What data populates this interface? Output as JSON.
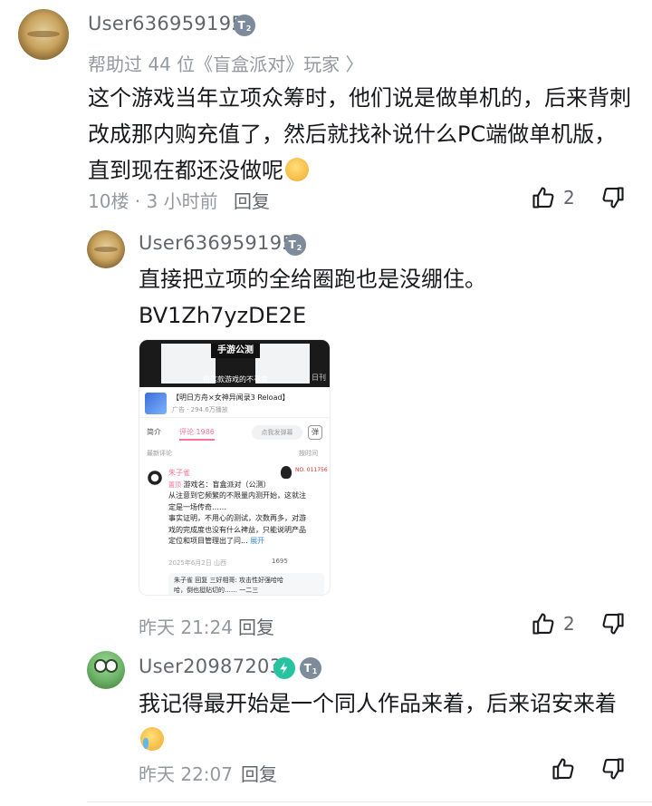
{
  "comment1": {
    "username": "User636959195",
    "badge": "T2",
    "helped": "帮助过 44 位《盲盒派对》玩家 〉",
    "text": "这个游戏当年立项众筹时，他们说是做单机的，后来背刺改成那内购充值了，然后就找补说什么PC端做单机版，直到现在都还没做呢",
    "meta": "10楼 · 3 小时前",
    "reply_label": "回复",
    "likes": "2"
  },
  "reply1": {
    "username": "User636959195",
    "badge": "T2",
    "text": "直接把立项的全给圈跑也是没绷住。",
    "bv": "BV1Zh7yzDE2E",
    "meta": "昨天 21:24",
    "reply_label": "回复",
    "likes": "2",
    "screenshot": {
      "video_title": "手游公测",
      "video_subtitle": "但这款游戏的不寻常",
      "watermark": "日刊",
      "ad_title": "【明日方舟×女神异闻录3 Reload】",
      "ad_meta": "广告 · 294.6万播放",
      "tab_intro": "简介",
      "tab_comments": "评论 1986",
      "danmaku_placeholder": "点我发弹幕",
      "danmaku_icon": "弹",
      "sort_newest": "最新评论",
      "sort_hot": "按时间",
      "commenter": "朱子雀",
      "tag": "置顶",
      "lines": [
        "游戏名：盲盒派对（公测）",
        "从注意到它频繁的不限量内测开始，这就注",
        "定是一场传奇……",
        "事实证明，不用心的测试，次数再多，对游",
        "戏的完成度也没有什么裨益，只能说明产品",
        "定位和项目管理出了问..."
      ],
      "more": "展开",
      "date": "2025年6月2日 山西",
      "like_count": "1695",
      "reply_preview_1": "朱子雀 回复 三好相哥: 攻击性好强哈哈",
      "reply_preview_2": "哈，倒也挺贴切的…… 一二三",
      "qq_label": "NO.\n011756"
    }
  },
  "reply2": {
    "username": "User20987203",
    "badge": "T1",
    "text": "我记得最开始是一个同人作品来着，后来诏安来着",
    "meta": "昨天 22:07",
    "reply_label": "回复"
  },
  "icons": {
    "like": "thumbs-up-icon",
    "dislike": "thumbs-down-icon"
  }
}
